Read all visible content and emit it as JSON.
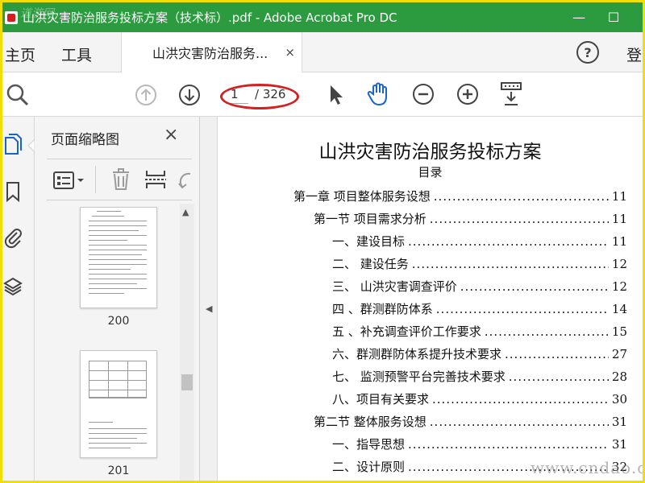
{
  "window": {
    "title": "山洪灾害防治服务投标方案（技术标）.pdf - Adobe Acrobat Pro DC",
    "watermark_top": "道游网",
    "minimize": "—",
    "maximize": "☐"
  },
  "tabs": {
    "home": "主页",
    "tools": "工具",
    "document": "山洪灾害防治服务...",
    "close": "×",
    "help": "?",
    "login": "登"
  },
  "toolbar": {
    "page_current": "1",
    "page_total": "/ 326"
  },
  "thumbnails": {
    "title": "页面缩略图",
    "close": "×",
    "pages": [
      {
        "number": "200"
      },
      {
        "number": "201"
      }
    ]
  },
  "document": {
    "title": "山洪灾害防治服务投标方案",
    "subtitle": "目录",
    "toc": [
      {
        "label": "第一章  项目整体服务设想",
        "page": "11",
        "level": 0
      },
      {
        "label": "第一节  项目需求分析",
        "page": "11",
        "level": 1
      },
      {
        "label": "一、建设目标",
        "page": "11",
        "level": 2
      },
      {
        "label": "二、 建设任务",
        "page": "12",
        "level": 2
      },
      {
        "label": "三、 山洪灾害调查评价",
        "page": "12",
        "level": 2
      },
      {
        "label": "四 、群测群防体系",
        "page": "14",
        "level": 2
      },
      {
        "label": "五 、补充调查评价工作要求",
        "page": "15",
        "level": 2
      },
      {
        "label": "六、群测群防体系提升技术要求",
        "page": "27",
        "level": 2
      },
      {
        "label": "七、 监测预警平台完善技术要求",
        "page": "28",
        "level": 2
      },
      {
        "label": "八、项目有关要求",
        "page": "30",
        "level": 2
      },
      {
        "label": "第二节  整体服务设想",
        "page": "31",
        "level": 1
      },
      {
        "label": "一、指导思想",
        "page": "31",
        "level": 2
      },
      {
        "label": "二、设计原则",
        "page": "32",
        "level": 2
      }
    ]
  },
  "watermark_bottom": "www.cndao.com",
  "colors": {
    "title_bar": "#2c9b3f",
    "outer_border": "#f2df00",
    "highlight_ellipse": "#d32020",
    "hand_tool": "#1a64c8"
  }
}
